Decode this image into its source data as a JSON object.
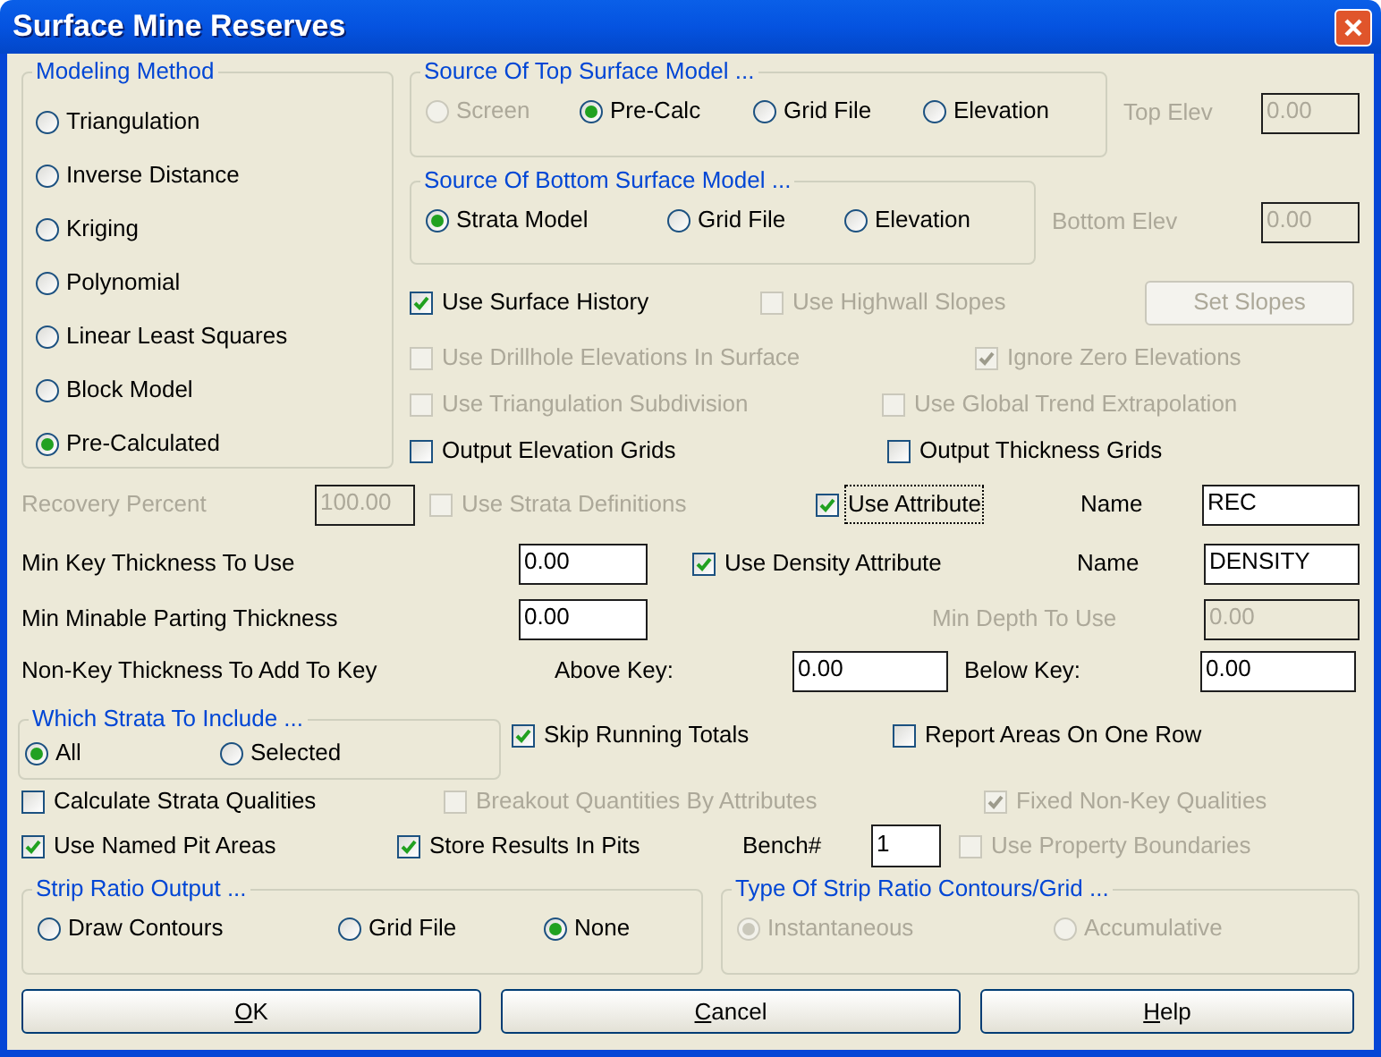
{
  "window": {
    "title": "Surface Mine Reserves"
  },
  "modeling_method": {
    "title": "Modeling Method",
    "options": [
      {
        "label": "Triangulation",
        "selected": false,
        "disabled": false
      },
      {
        "label": "Inverse Distance",
        "selected": false,
        "disabled": false
      },
      {
        "label": "Kriging",
        "selected": false,
        "disabled": false
      },
      {
        "label": "Polynomial",
        "selected": false,
        "disabled": false
      },
      {
        "label": "Linear Least Squares",
        "selected": false,
        "disabled": false
      },
      {
        "label": "Block Model",
        "selected": false,
        "disabled": false
      },
      {
        "label": "Pre-Calculated",
        "selected": true,
        "disabled": false
      }
    ]
  },
  "top_surface": {
    "title": "Source Of Top Surface Model ...",
    "options": [
      {
        "label": "Screen",
        "selected": false,
        "disabled": true
      },
      {
        "label": "Pre-Calc",
        "selected": true,
        "disabled": false
      },
      {
        "label": "Grid File",
        "selected": false,
        "disabled": false
      },
      {
        "label": "Elevation",
        "selected": false,
        "disabled": false
      }
    ]
  },
  "top_elev": {
    "label": "Top Elev",
    "value": "0.00",
    "disabled": true
  },
  "bottom_surface": {
    "title": "Source Of Bottom Surface Model ...",
    "options": [
      {
        "label": "Strata Model",
        "selected": true,
        "disabled": false
      },
      {
        "label": "Grid File",
        "selected": false,
        "disabled": false
      },
      {
        "label": "Elevation",
        "selected": false,
        "disabled": false
      }
    ]
  },
  "bottom_elev": {
    "label": "Bottom Elev",
    "value": "0.00",
    "disabled": true
  },
  "surface_options": [
    {
      "label": "Use Surface History",
      "checked": true,
      "disabled": false
    },
    {
      "label": "Use Highwall Slopes",
      "checked": false,
      "disabled": true
    },
    {
      "label": "Use Drillhole Elevations In Surface",
      "checked": false,
      "disabled": true
    },
    {
      "label": "Ignore Zero Elevations",
      "checked": true,
      "disabled": true
    },
    {
      "label": "Use Triangulation Subdivision",
      "checked": false,
      "disabled": true
    },
    {
      "label": "Use Global Trend Extrapolation",
      "checked": false,
      "disabled": true
    },
    {
      "label": "Output Elevation Grids",
      "checked": false,
      "disabled": false
    },
    {
      "label": "Output Thickness Grids",
      "checked": false,
      "disabled": false
    }
  ],
  "set_slopes_button": {
    "label": "Set Slopes",
    "disabled": true
  },
  "recovery_percent": {
    "label": "Recovery Percent",
    "value": "100.00",
    "disabled": true
  },
  "use_strata_definitions": {
    "label": "Use Strata Definitions",
    "checked": false,
    "disabled": true
  },
  "use_attribute": {
    "label": "Use Attribute",
    "checked": true,
    "disabled": false,
    "focused": true
  },
  "attribute_name": {
    "label": "Name",
    "value": "REC",
    "disabled": false
  },
  "min_key_thickness": {
    "label": "Min Key Thickness To Use",
    "value": "0.00",
    "disabled": false
  },
  "use_density_attribute": {
    "label": "Use Density Attribute",
    "checked": true,
    "disabled": false
  },
  "density_name": {
    "label": "Name",
    "value": "DENSITY",
    "disabled": false
  },
  "min_parting_thickness": {
    "label": "Min Minable Parting Thickness",
    "value": "0.00",
    "disabled": false
  },
  "min_depth": {
    "label": "Min Depth To Use",
    "value": "0.00",
    "disabled": true
  },
  "non_key_thickness": {
    "label": "Non-Key Thickness To Add To Key",
    "above": {
      "label": "Above Key:",
      "value": "0.00",
      "disabled": false
    },
    "below": {
      "label": "Below Key:",
      "value": "0.00",
      "disabled": false
    }
  },
  "which_strata": {
    "title": "Which Strata To Include ...",
    "options": [
      {
        "label": "All",
        "selected": true,
        "disabled": false
      },
      {
        "label": "Selected",
        "selected": false,
        "disabled": false
      }
    ]
  },
  "skip_running_totals": {
    "label": "Skip Running Totals",
    "checked": true,
    "disabled": false
  },
  "report_areas_one_row": {
    "label": "Report Areas On One Row",
    "checked": false,
    "disabled": false
  },
  "calculate_strata_qualities": {
    "label": "Calculate Strata Qualities",
    "checked": false,
    "disabled": false
  },
  "breakout_quantities": {
    "label": "Breakout Quantities By Attributes",
    "checked": false,
    "disabled": true
  },
  "fixed_non_key_qualities": {
    "label": "Fixed Non-Key Qualities",
    "checked": true,
    "disabled": true
  },
  "use_named_pit_areas": {
    "label": "Use Named Pit Areas",
    "checked": true,
    "disabled": false
  },
  "store_results_in_pits": {
    "label": "Store Results In Pits",
    "checked": true,
    "disabled": false
  },
  "bench": {
    "label": "Bench#",
    "value": "1",
    "disabled": false
  },
  "use_property_boundaries": {
    "label": "Use Property Boundaries",
    "checked": false,
    "disabled": true
  },
  "strip_ratio_output": {
    "title": "Strip Ratio Output ...",
    "options": [
      {
        "label": "Draw Contours",
        "selected": false,
        "disabled": false
      },
      {
        "label": "Grid File",
        "selected": false,
        "disabled": false
      },
      {
        "label": "None",
        "selected": true,
        "disabled": false
      }
    ]
  },
  "strip_ratio_type": {
    "title": "Type Of Strip Ratio Contours/Grid ...",
    "options": [
      {
        "label": "Instantaneous",
        "selected": true,
        "disabled": true
      },
      {
        "label": "Accumulative",
        "selected": false,
        "disabled": true
      }
    ]
  },
  "buttons": [
    {
      "label": "OK",
      "first_letter_underlined": true
    },
    {
      "label": "Cancel",
      "first_letter_underlined": true
    },
    {
      "label": "Help",
      "first_letter_underlined": true
    }
  ]
}
